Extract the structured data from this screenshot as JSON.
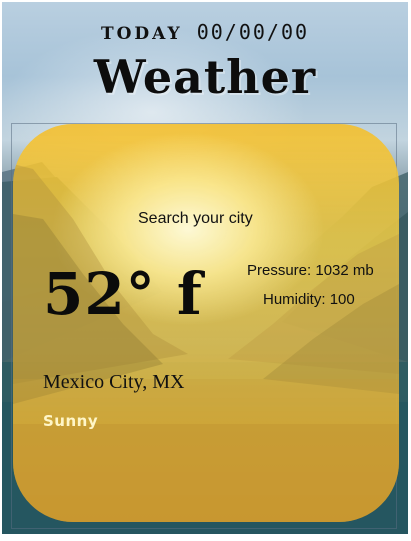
{
  "header": {
    "today_label": "TODAY",
    "date": "00/00/00",
    "title": "Weather"
  },
  "card": {
    "search_label": "Search your city",
    "temperature": "52° f",
    "pressure_label": "Pressure:",
    "pressure_value": "1032 mb",
    "humidity_label": "Humidity:",
    "humidity_value": "100",
    "city": "Mexico City, MX",
    "condition": "Sunny"
  },
  "colors": {
    "card_yellow": "#f5c642",
    "condition_text": "#fff6c8",
    "lake_teal": "#2f5960"
  },
  "icons": [
    "mountain-lake-background"
  ]
}
